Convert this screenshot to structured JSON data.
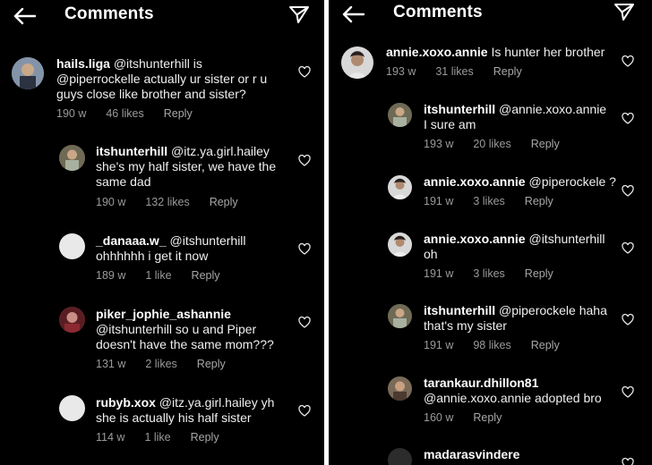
{
  "left": {
    "title": "Comments",
    "comments": [
      {
        "username": "hails.liga",
        "text": "@itshunterhill is @piperrockelle actually ur sister or r u guys close like brother and sister?",
        "time": "190 w",
        "likes": "46 likes",
        "reply": "Reply"
      },
      {
        "username": "itshunterhill",
        "text": "@itz.ya.girl.hailey she's my half sister, we have the same dad",
        "time": "190 w",
        "likes": "132 likes",
        "reply": "Reply"
      },
      {
        "username": "_danaaa.w_",
        "text": "@itshunterhill ohhhhhh i get it now",
        "time": "189 w",
        "likes": "1 like",
        "reply": "Reply"
      },
      {
        "username": "piker_jophie_ashannie",
        "text": "@itshunterhill so u and Piper doesn't have the same mom???",
        "time": "131 w",
        "likes": "2 likes",
        "reply": "Reply"
      },
      {
        "username": "rubyb.xox",
        "text": "@itz.ya.girl.hailey yh she is actually his half sister",
        "time": "114 w",
        "likes": "1 like",
        "reply": "Reply"
      }
    ]
  },
  "right": {
    "title": "Comments",
    "comments": [
      {
        "username": "annie.xoxo.annie",
        "text": "Is hunter her brother",
        "time": "193 w",
        "likes": "31 likes",
        "reply": "Reply"
      },
      {
        "username": "itshunterhill",
        "text": "@annie.xoxo.annie I sure am",
        "time": "193 w",
        "likes": "20 likes",
        "reply": "Reply"
      },
      {
        "username": "annie.xoxo.annie",
        "text": "@piperockele ?",
        "time": "191 w",
        "likes": "3 likes",
        "reply": "Reply"
      },
      {
        "username": "annie.xoxo.annie",
        "text": "@itshunterhill oh",
        "time": "191 w",
        "likes": "3 likes",
        "reply": "Reply"
      },
      {
        "username": "itshunterhill",
        "text": "@piperockele haha that's my sister",
        "time": "191 w",
        "likes": "98 likes",
        "reply": "Reply"
      },
      {
        "username": "tarankaur.dhillon81",
        "text": "@annie.xoxo.annie adopted bro",
        "time": "160 w",
        "likes": "",
        "reply": "Reply"
      },
      {
        "username": "madarasvindere",
        "text": "",
        "time": "",
        "likes": "",
        "reply": ""
      }
    ]
  }
}
